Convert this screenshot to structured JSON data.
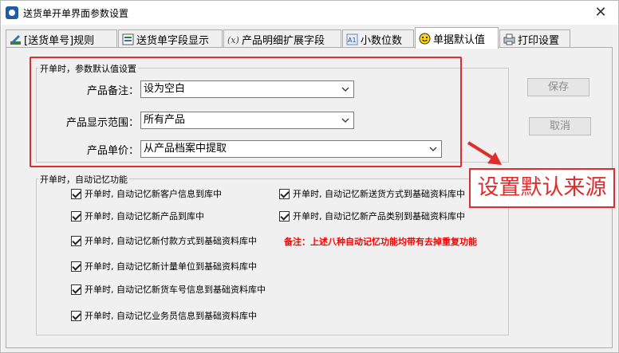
{
  "window": {
    "title": "送货单开单界面参数设置",
    "close_glyph": "✕"
  },
  "tabs": [
    {
      "label": "[送货单号]规则",
      "icon": "pencil-ruler-icon",
      "active": false
    },
    {
      "label": "送货单字段显示",
      "icon": "fields-icon",
      "active": false
    },
    {
      "label": "产品明细扩展字段",
      "icon": "function-icon",
      "active": false
    },
    {
      "label": "小数位数",
      "icon": "decimal-icon",
      "active": false
    },
    {
      "label": "单据默认值",
      "icon": "smiley-icon",
      "active": true
    },
    {
      "label": "打印设置",
      "icon": "printer-icon",
      "active": false
    }
  ],
  "defaults_group": {
    "label": "开单时，参数默认值设置",
    "fields": [
      {
        "label": "产品备注：",
        "value": "设为空白"
      },
      {
        "label": "产品显示范围：",
        "value": "所有产品"
      },
      {
        "label": "产品单价：",
        "value": "从产品档案中提取"
      }
    ]
  },
  "buttons": {
    "save": "保存",
    "cancel": "取消"
  },
  "memory_group": {
    "label": "开单时，自动记忆功能",
    "checkboxes": [
      {
        "label": "开单时, 自动记忆新客户信息到库中",
        "checked": true
      },
      {
        "label": "开单时, 自动记忆新送货方式到基础资料库中",
        "checked": true
      },
      {
        "label": "开单时, 自动记忆新产品到库中",
        "checked": true
      },
      {
        "label": "开单时, 自动记忆新产品类别到基础资料库中",
        "checked": true
      },
      {
        "label": "开单时, 自动记忆新付款方式到基础资料库中",
        "checked": true
      },
      {
        "label": "开单时, 自动记忆新计量单位到基础资料库中",
        "checked": true
      },
      {
        "label": "开单时, 自动记忆新货车号信息到基础资料库中",
        "checked": true
      },
      {
        "label": "开单时, 自动记忆业务员信息到基础资料库中",
        "checked": true
      }
    ],
    "note": "备注：上述八种自动记忆功能均带有去掉重复功能"
  },
  "annotation": {
    "callout_text": "设置默认来源"
  },
  "colors": {
    "highlight_red": "#e02c2c",
    "note_red": "#ff0000"
  }
}
